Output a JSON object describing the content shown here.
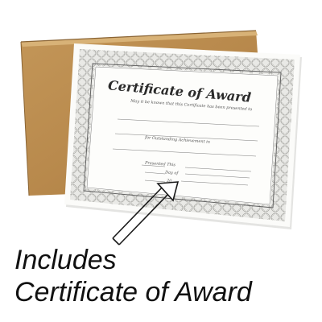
{
  "certificate": {
    "title": "Certificate of Award",
    "subtitle": "May it be known that this Certificate has been presented to",
    "achievement_line": "for Outstanding Achievement in",
    "presented_line": "Presented This",
    "day_line": "Day of",
    "year_line": "20"
  },
  "caption": {
    "line1": "Includes",
    "line2": "Certificate of Award"
  },
  "colors": {
    "folder": "#b8894c",
    "folder_edge": "#8a6434",
    "paper": "#fbfbf9",
    "border_pattern": "#9a9a96",
    "frame_line": "#5a5a5a",
    "caption_text": "#111111"
  },
  "icons": [
    "arrow-icon"
  ]
}
